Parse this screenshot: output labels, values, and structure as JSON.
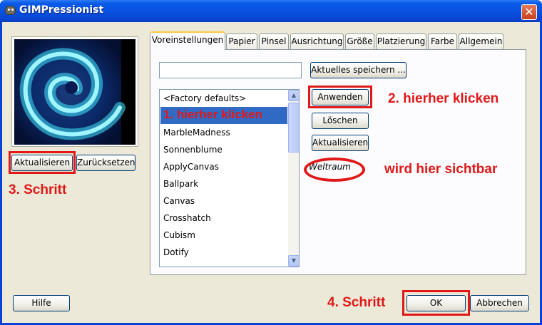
{
  "window": {
    "title": "GIMPressionist",
    "close_glyph": "✕"
  },
  "preview": {
    "update_button": "Aktualisieren",
    "reset_button": "Zurücksetzen"
  },
  "tabs": [
    {
      "label": "Voreinstellungen",
      "active": true
    },
    {
      "label": "Papier"
    },
    {
      "label": "Pinsel"
    },
    {
      "label": "Ausrichtung"
    },
    {
      "label": "Größe"
    },
    {
      "label": "Platzierung"
    },
    {
      "label": "Farbe"
    },
    {
      "label": "Allgemein"
    }
  ],
  "presets": {
    "name_input_value": "",
    "save_button": "Aktuelles speichern ...",
    "apply_button": "Anwenden",
    "delete_button": "Löschen",
    "refresh_button": "Aktualisieren",
    "selected_description": "Weltraum",
    "list": [
      "<Factory defaults>",
      "",
      "MarbleMadness",
      "Sonnenblume",
      "ApplyCanvas",
      "Ballpark",
      "Canvas",
      "Crosshatch",
      "Cubism",
      "Dotify"
    ]
  },
  "footer": {
    "help_button": "Hilfe",
    "ok_button": "OK",
    "cancel_button": "Abbrechen"
  },
  "annotations": {
    "step1": "1. hierher klicken",
    "step2": "2. hierher klicken",
    "step3": "3. Schritt",
    "step4": "4. Schritt",
    "visible_here": "wird hier sichtbar"
  },
  "colors": {
    "annotation_red": "#e01818",
    "selection_blue": "#316ac5",
    "titlebar_blue": "#0a5ae8"
  }
}
